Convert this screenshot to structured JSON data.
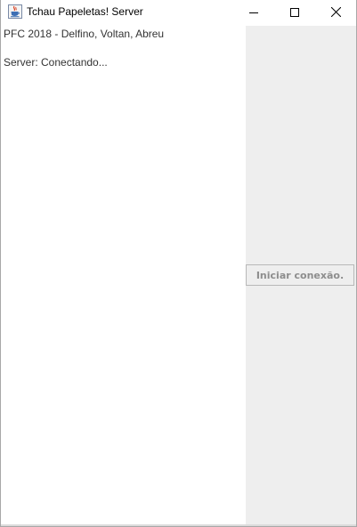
{
  "window": {
    "title": "Tchau Papeletas! Server",
    "app_icon": "java-cup-icon"
  },
  "controls": {
    "minimize_icon": "minimize-icon",
    "maximize_icon": "maximize-icon",
    "close_icon": "close-icon"
  },
  "log": {
    "lines": [
      "PFC 2018 - Delfino, Voltan, Abreu",
      "Server: Conectando..."
    ]
  },
  "side_panel": {
    "connect_button_label": "Iniciar conexão.",
    "connect_button_state": "disabled"
  },
  "colors": {
    "panel_background": "#eeeeee",
    "disabled_text": "#8d8d8d",
    "log_text": "#333333"
  }
}
